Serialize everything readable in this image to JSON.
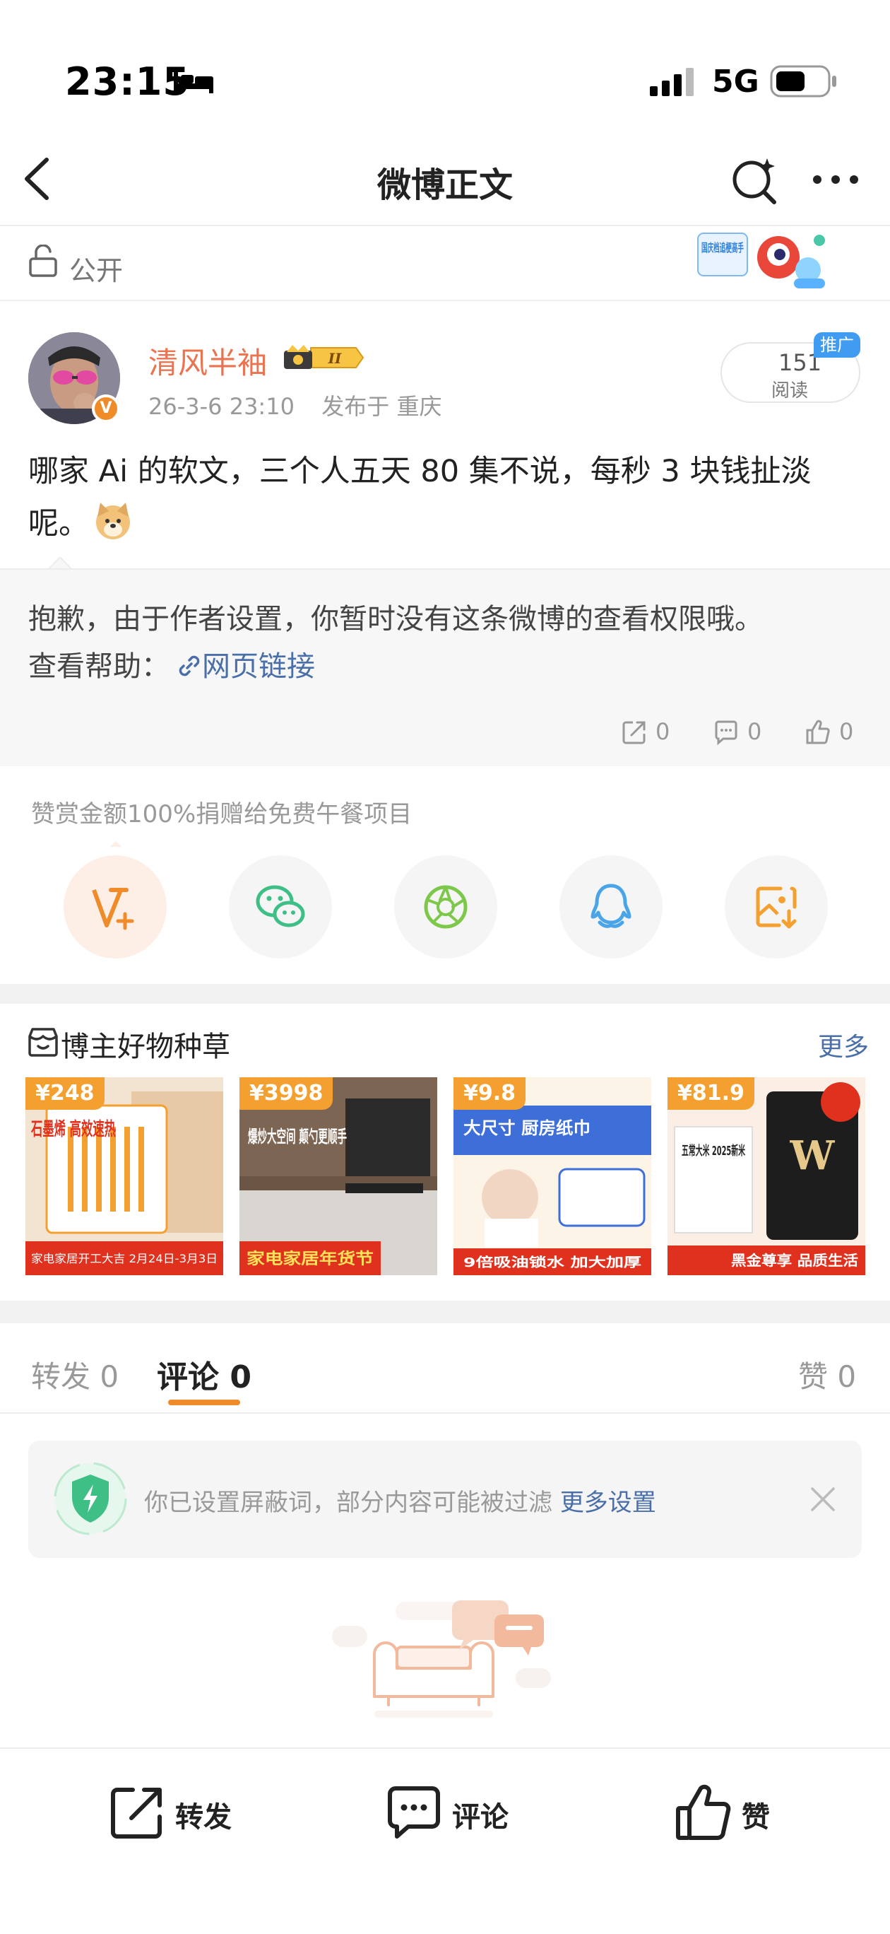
{
  "status_bar": {
    "time": "23:15",
    "network": "5G"
  },
  "nav": {
    "title": "微博正文"
  },
  "visibility": {
    "label": "公开",
    "banner_text": "国庆档追梗高手"
  },
  "author": {
    "name": "清风半袖",
    "level_badge": "II",
    "date": "26-3-6 23:10",
    "location": "发布于 重庆",
    "reads_count": "151",
    "reads_label": "阅读",
    "promo_tag": "推广"
  },
  "post": {
    "text": "哪家 Ai 的软文，三个人五天 80 集不说，每秒 3 块钱扯淡呢。"
  },
  "restricted": {
    "message": "抱歉，由于作者设置，你暂时没有这条微博的查看权限哦。",
    "help_prefix": "查看帮助：",
    "help_link": "网页链接",
    "repost_count": "0",
    "comment_count": "0",
    "like_count": "0"
  },
  "donate": {
    "note": "赞赏金额100%捐赠给免费午餐项目"
  },
  "goods": {
    "title": "博主好物种草",
    "more": "更多",
    "items": [
      {
        "price": "¥248",
        "image_text": "石墨烯 高效速热",
        "promo": "家电家居开工大吉 2月24日-3月3日"
      },
      {
        "price": "¥3998",
        "image_text": "爆炒大空间 颠勺更顺手",
        "promo": "家电家居年货节"
      },
      {
        "price": "¥9.8",
        "image_text": "大尺寸 厨房纸巾",
        "promo": "9倍吸油锁水 加大加厚"
      },
      {
        "price": "¥81.9",
        "image_text": "五常大米 2025新米",
        "promo": "黑金尊享 品质生活"
      }
    ]
  },
  "tabs": {
    "repost": "转发 0",
    "comment": "评论 0",
    "like": "赞 0"
  },
  "filter_notice": {
    "text": "你已设置屏蔽词，部分内容可能被过滤",
    "link": "更多设置"
  },
  "bottom_bar": {
    "repost": "转发",
    "comment": "评论",
    "like": "赞"
  },
  "colors": {
    "accent": "#f08b2a",
    "link": "#4a6fa8",
    "author": "#eb7350"
  }
}
